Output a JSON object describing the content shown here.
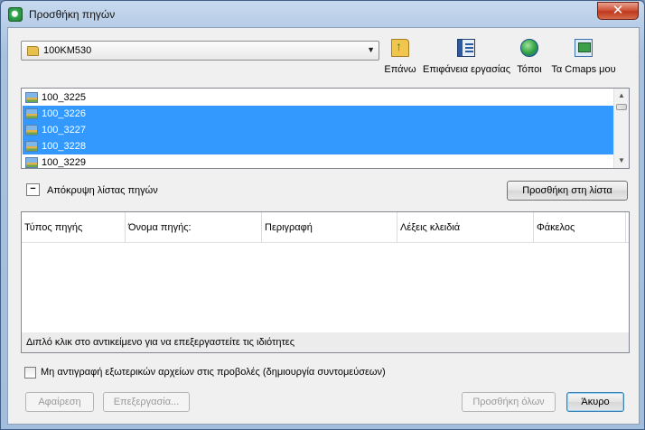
{
  "window": {
    "title": "Προσθήκη πηγών",
    "close_glyph": "✕"
  },
  "location": {
    "value": "100KM530",
    "arrow": "▼"
  },
  "toolbar": [
    {
      "label": "Επάνω",
      "icon": "folder-up-icon"
    },
    {
      "label": "Επιφάνεια εργασίας",
      "icon": "desktop-icon"
    },
    {
      "label": "Τόποι",
      "icon": "places-globe-icon"
    },
    {
      "label": "Τα Cmaps μου",
      "icon": "my-cmaps-icon"
    }
  ],
  "resources": [
    {
      "name": "100_3225",
      "selected": false
    },
    {
      "name": "100_3226",
      "selected": true
    },
    {
      "name": "100_3227",
      "selected": true
    },
    {
      "name": "100_3228",
      "selected": true
    },
    {
      "name": "100_3229",
      "selected": false
    }
  ],
  "scrollbar": {
    "up": "▲",
    "down": "▼"
  },
  "hide_list": {
    "toggle_glyph": "−",
    "label": "Απόκρυψη λίστας πηγών"
  },
  "add_to_list_button": "Προσθήκη στη λίστα",
  "table": {
    "columns": [
      "Τύπος πηγής",
      "Όνομα πηγής:",
      "Περιγραφή",
      "Λέξεις κλειδιά",
      "Φάκελος"
    ],
    "hint": "Διπλό κλικ στο αντικείμενο για να επεξεργαστείτε τις ιδιότητες"
  },
  "no_copy_checkbox": {
    "label": "Μη αντιγραφή εξωτερικών αρχείων στις προβολές (δημιουργία συντομεύσεων)",
    "checked": false
  },
  "buttons": {
    "remove": "Αφαίρεση",
    "edit": "Επεξεργασία...",
    "add_all": "Προσθήκη όλων",
    "cancel": "Άκυρο"
  },
  "colors": {
    "selection": "#3399ff",
    "title_bar": "#b7cde7",
    "close_button": "#c7402a"
  }
}
